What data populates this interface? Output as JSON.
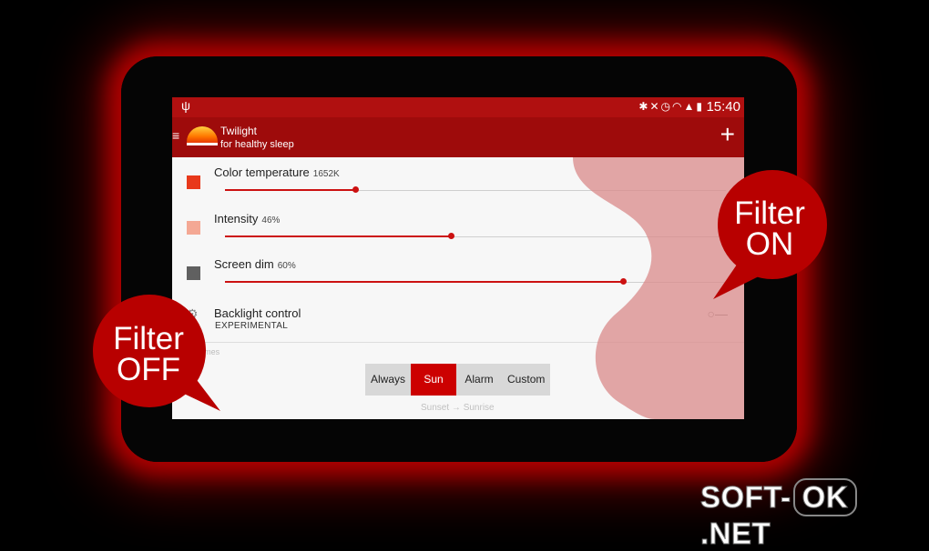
{
  "status_bar": {
    "time": "15:40",
    "left_icon": "usb-icon",
    "icons": [
      "bluetooth-icon",
      "mute-icon",
      "alarm-icon",
      "wifi-icon",
      "signal-icon",
      "battery-charging-icon"
    ]
  },
  "app": {
    "title": "Twilight",
    "subtitle": "for healthy sleep",
    "add_label": "+"
  },
  "settings": [
    {
      "label": "Color temperature",
      "value": "1652K",
      "color": "#e8391b",
      "level": 0.26
    },
    {
      "label": "Intensity",
      "value": "46%",
      "color": "#f4a894",
      "level": 0.45
    },
    {
      "label": "Screen dim",
      "value": "60%",
      "color": "#606060",
      "level": 0.795
    }
  ],
  "backlight": {
    "label": "Backlight control",
    "sub": "EXPERIMENTAL"
  },
  "times": {
    "label": "Times",
    "options": [
      "Always",
      "Sun",
      "Alarm",
      "Custom"
    ],
    "selected": "Sun",
    "range_text": "Sunset → Sunrise"
  },
  "callouts": {
    "on": {
      "line1": "Filter",
      "line2": "ON"
    },
    "off": {
      "line1": "Filter",
      "line2": "OFF"
    }
  },
  "watermark": {
    "a": "SOFT-",
    "b": "OK",
    "c": ".NET"
  },
  "colors": {
    "accent": "#cc0000",
    "appbar": "#9e0b0b",
    "filter_overlay": "#d98a8a"
  }
}
